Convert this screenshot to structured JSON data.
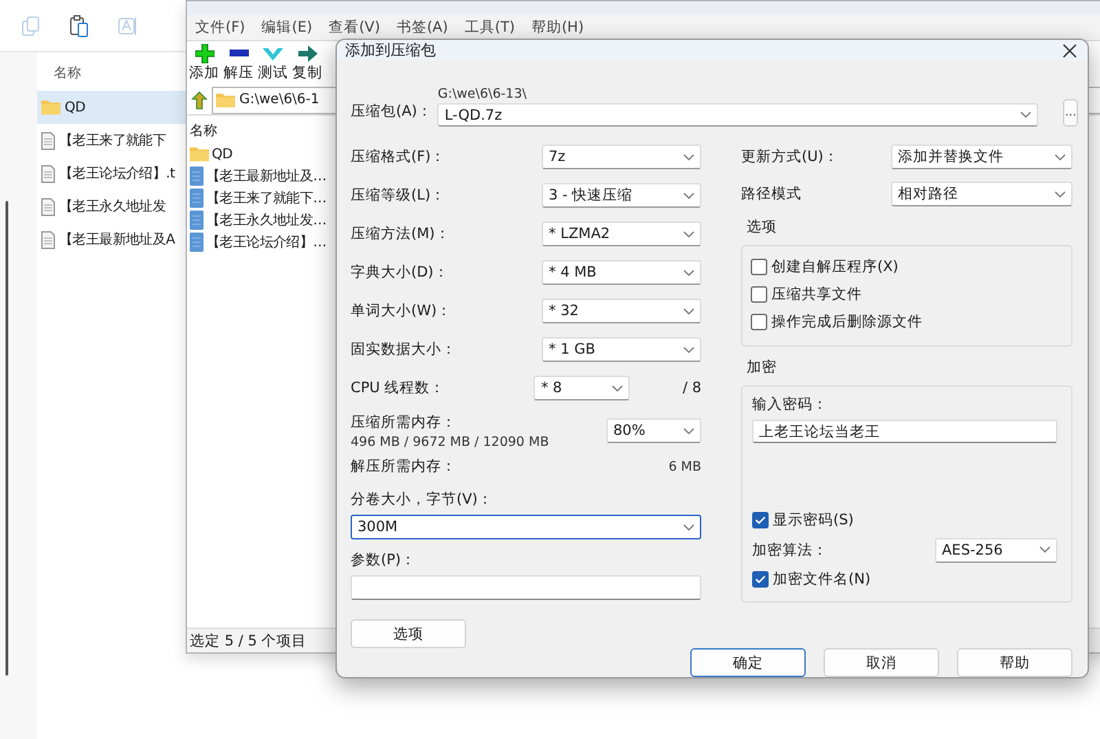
{
  "explorer": {
    "column_header": "名称",
    "items": [
      {
        "name": "QD",
        "kind": "folder",
        "selected": true
      },
      {
        "name": "【老王来了就能下",
        "kind": "file",
        "selected": false
      },
      {
        "name": "【老王论坛介绍】.t",
        "kind": "file",
        "selected": false
      },
      {
        "name": "【老王永久地址发",
        "kind": "file",
        "selected": false
      },
      {
        "name": "【老王最新地址及A",
        "kind": "file",
        "selected": false
      }
    ]
  },
  "archiver": {
    "menu": [
      "文件(F)",
      "编辑(E)",
      "查看(V)",
      "书签(A)",
      "工具(T)",
      "帮助(H)"
    ],
    "toolbar": [
      {
        "label": "添加",
        "kind": "add"
      },
      {
        "label": "解压",
        "kind": "extract"
      },
      {
        "label": "测试",
        "kind": "test"
      },
      {
        "label": "复制",
        "kind": "copy"
      }
    ],
    "path": "G:\\we\\6\\6-1",
    "list_header": "名称",
    "items": [
      {
        "name": "QD",
        "kind": "folder"
      },
      {
        "name": "【老王最新地址及…",
        "kind": "file"
      },
      {
        "name": "【老王来了就能下…",
        "kind": "file"
      },
      {
        "name": "【老王永久地址发…",
        "kind": "file"
      },
      {
        "name": "【老王论坛介绍】…",
        "kind": "file"
      }
    ],
    "status": "选定 5 / 5 个项目"
  },
  "dialog": {
    "title": "添加到压缩包",
    "archive": {
      "label": "压缩包(A)：",
      "folder": "G:\\we\\6\\6-13\\",
      "value": "L-QD.7z",
      "browse": "..."
    },
    "settings": [
      {
        "label": "压缩格式(F)：",
        "value": "7z"
      },
      {
        "label": "压缩等级(L)：",
        "value": "3 - 快速压缩"
      },
      {
        "label": "压缩方法(M)：",
        "value": "* LZMA2"
      },
      {
        "label": "字典大小(D)：",
        "value": "* 4 MB"
      },
      {
        "label": "单词大小(W)：",
        "value": "* 32"
      },
      {
        "label": "固实数据大小：",
        "value": "* 1 GB"
      },
      {
        "label": "CPU 线程数：",
        "value": "* 8",
        "note": "/ 8"
      }
    ],
    "memory": {
      "label": "压缩所需内存：",
      "detail": "496 MB / 9672 MB / 12090 MB",
      "value": "80%"
    },
    "decompress_memory": {
      "label": "解压所需内存：",
      "value": "6 MB"
    },
    "volume": {
      "label": "分卷大小，字节(V)：",
      "value": "300M",
      "focused": true
    },
    "parameters": {
      "label": "参数(P)："
    },
    "options_button": "选项",
    "update_mode": {
      "label": "更新方式(U)：",
      "value": "添加并替换文件"
    },
    "path_mode": {
      "label": "路径模式",
      "value": "相对路径"
    },
    "options": {
      "title": "选项",
      "checkboxes": [
        {
          "label": "创建自解压程序(X)",
          "checked": false
        },
        {
          "label": "压缩共享文件",
          "checked": false
        },
        {
          "label": "操作完成后删除源文件",
          "checked": false
        }
      ]
    },
    "encryption": {
      "title": "加密",
      "password_label": "输入密码：",
      "password": "上老王论坛当老王",
      "show_password": {
        "label": "显示密码(S)",
        "checked": true
      },
      "method": {
        "label": "加密算法：",
        "value": "AES-256"
      },
      "encrypt_names": {
        "label": "加密文件名(N)",
        "checked": true
      }
    },
    "buttons": [
      {
        "label": "确定",
        "default": true
      },
      {
        "label": "取消",
        "default": false
      },
      {
        "label": "帮助",
        "default": false
      }
    ]
  }
}
